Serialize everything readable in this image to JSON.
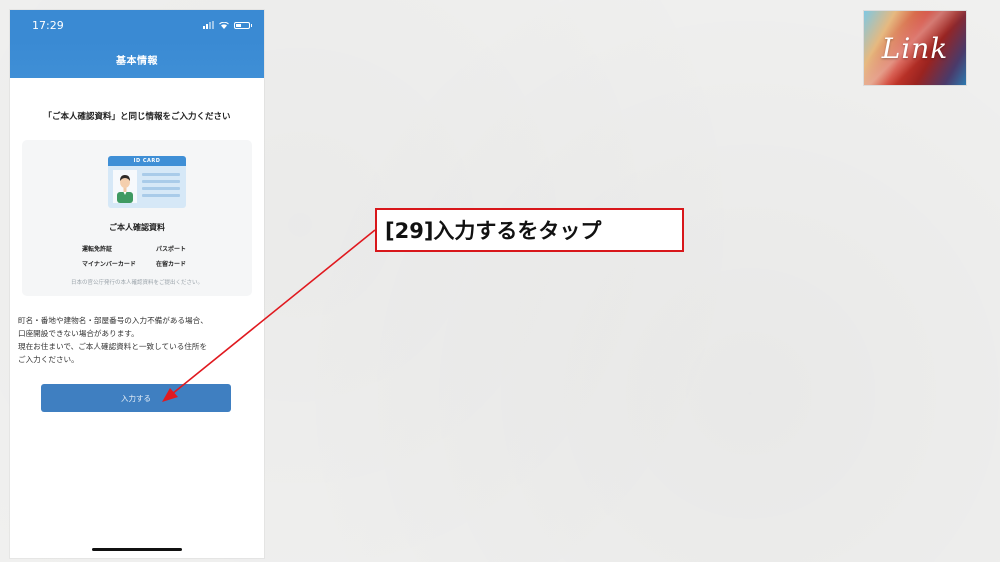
{
  "status_bar": {
    "time": "17:29"
  },
  "nav": {
    "title": "基本情報"
  },
  "instruction": "「ご本人確認資料」と同じ情報をご入力ください",
  "id_section": {
    "card_label": "ID CARD",
    "title": "ご本人確認資料",
    "documents": [
      "運転免許証",
      "パスポート",
      "マイナンバーカード",
      "在留カード"
    ],
    "note": "日本の官公庁発行の本人確認資料をご提出ください。"
  },
  "warning": {
    "line1": "町名・番地や建物名・部屋番号の入力不備がある場合、",
    "line2": "口座開設できない場合があります。",
    "line3": "現在お住まいで、ご本人確認資料と一致している住所を",
    "line4": "ご入力ください。"
  },
  "submit_button": "入力する",
  "logo": {
    "text": "Link"
  },
  "callout": {
    "text": "[29]入力するをタップ"
  },
  "colors": {
    "primary": "#3a8ad3",
    "button": "#3f7fc1",
    "callout_border": "#d8171b"
  }
}
